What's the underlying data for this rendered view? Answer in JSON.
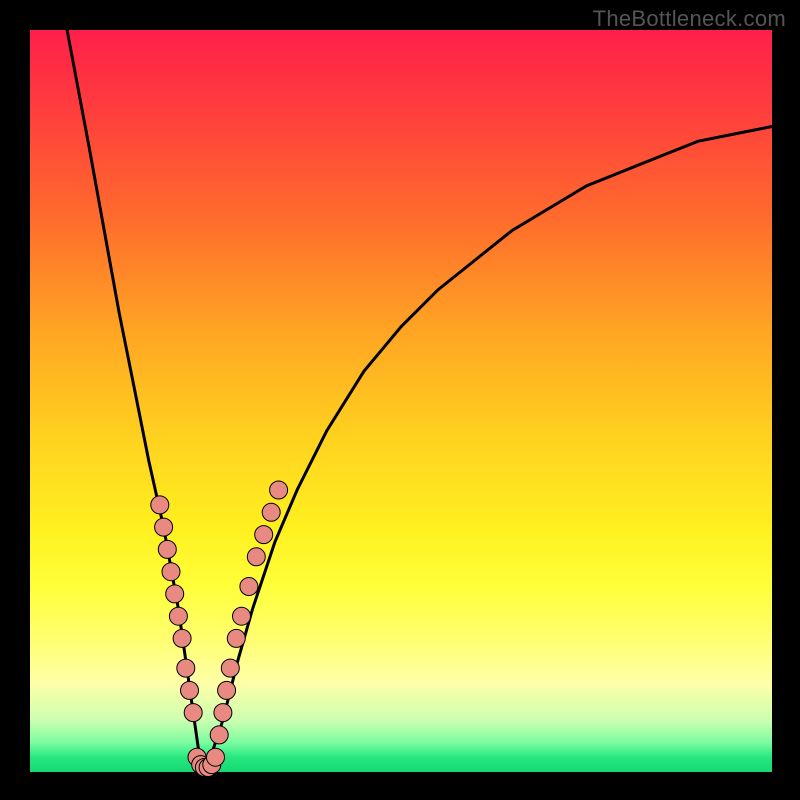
{
  "watermark": "TheBottleneck.com",
  "colors": {
    "curve_stroke": "#000000",
    "dot_fill": "#e98a82",
    "dot_stroke": "#000000",
    "background_black": "#000000"
  },
  "chart_data": {
    "type": "line",
    "title": "",
    "xlabel": "",
    "ylabel": "",
    "xlim": [
      0,
      100
    ],
    "ylim": [
      0,
      100
    ],
    "note": "V-shaped bottleneck curve; y value = bottleneck percentage, minimum near x≈23. Background gradient encodes severity (red high, green zero).",
    "series": [
      {
        "name": "bottleneck_curve",
        "x": [
          5,
          8,
          10,
          12,
          14,
          16,
          18,
          20,
          22,
          23,
          24,
          26,
          28,
          30,
          33,
          36,
          40,
          45,
          50,
          55,
          60,
          65,
          70,
          75,
          80,
          85,
          90,
          95,
          100
        ],
        "y": [
          100,
          84,
          73,
          62,
          52,
          42,
          33,
          22,
          8,
          1,
          1,
          7,
          15,
          22,
          31,
          38,
          46,
          54,
          60,
          65,
          69,
          73,
          76,
          79,
          81,
          83,
          85,
          86,
          87
        ]
      }
    ],
    "flat_bottom": {
      "x_start": 22.5,
      "x_end": 24.5,
      "y": 0.5
    },
    "dots": {
      "left_branch": [
        {
          "x": 17.5,
          "y": 36
        },
        {
          "x": 18,
          "y": 33
        },
        {
          "x": 18.5,
          "y": 30
        },
        {
          "x": 19,
          "y": 27
        },
        {
          "x": 19.5,
          "y": 24
        },
        {
          "x": 20,
          "y": 21
        },
        {
          "x": 20.5,
          "y": 18
        },
        {
          "x": 21,
          "y": 14
        },
        {
          "x": 21.5,
          "y": 11
        },
        {
          "x": 22,
          "y": 8
        }
      ],
      "bottom": [
        {
          "x": 22.5,
          "y": 2
        },
        {
          "x": 23,
          "y": 1
        },
        {
          "x": 23.5,
          "y": 0.6
        },
        {
          "x": 24,
          "y": 0.6
        },
        {
          "x": 24.5,
          "y": 1
        },
        {
          "x": 25,
          "y": 2
        }
      ],
      "right_branch": [
        {
          "x": 25.5,
          "y": 5
        },
        {
          "x": 26,
          "y": 8
        },
        {
          "x": 26.5,
          "y": 11
        },
        {
          "x": 27,
          "y": 14
        },
        {
          "x": 27.8,
          "y": 18
        },
        {
          "x": 28.5,
          "y": 21
        },
        {
          "x": 29.5,
          "y": 25
        },
        {
          "x": 30.5,
          "y": 29
        },
        {
          "x": 31.5,
          "y": 32
        },
        {
          "x": 32.5,
          "y": 35
        },
        {
          "x": 33.5,
          "y": 38
        }
      ]
    }
  }
}
